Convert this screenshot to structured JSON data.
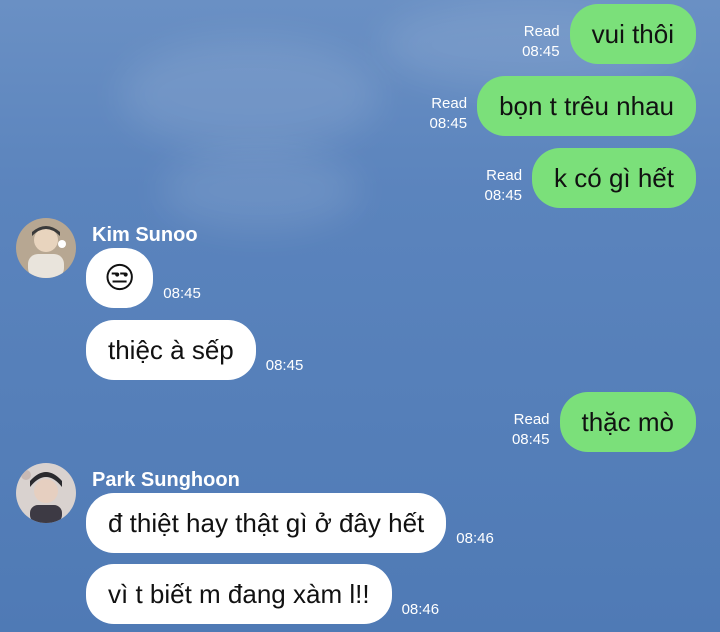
{
  "messages_out": [
    {
      "text": "vui thôi",
      "status": "Read",
      "time": "08:45"
    },
    {
      "text": "bọn t trêu nhau",
      "status": "Read",
      "time": "08:45"
    },
    {
      "text": "k có gì hết",
      "status": "Read",
      "time": "08:45"
    },
    {
      "text": "thặc mò",
      "status": "Read",
      "time": "08:45"
    }
  ],
  "users": [
    {
      "name": "Kim Sunoo"
    },
    {
      "name": "Park Sunghoon"
    }
  ],
  "messages_in": [
    {
      "text": "😒",
      "time": "08:45"
    },
    {
      "text": "thiệc à sếp",
      "time": "08:45"
    },
    {
      "text": "đ thiệt hay thật gì ở đây hết",
      "time": "08:46"
    },
    {
      "text": "vì t biết m đang xàm l!!",
      "time": "08:46"
    }
  ]
}
